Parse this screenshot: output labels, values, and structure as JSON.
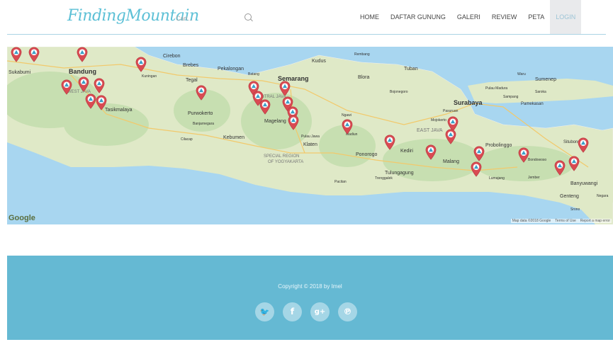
{
  "header": {
    "logo": "FindingMountain",
    "search_placeholder": "Cari...",
    "nav": [
      {
        "label": "HOME"
      },
      {
        "label": "DAFTAR GUNUNG"
      },
      {
        "label": "GALERI"
      },
      {
        "label": "REVIEW"
      },
      {
        "label": "PETA"
      },
      {
        "label": "LOGIN"
      }
    ]
  },
  "map": {
    "provider": "Google",
    "attribution": [
      "Map data ©2018 Google",
      "Terms of Use",
      "Report a map error"
    ],
    "labels": {
      "sukabumi": "Sukabumi",
      "bandung": "Bandung",
      "cirebon": "Cirebon",
      "kuningan": "Kuningan",
      "brebes": "Brebes",
      "tegal": "Tegal",
      "pekalongan": "Pekalongan",
      "batang": "Batang",
      "semarang": "Semarang",
      "kudus": "Kudus",
      "rembang": "Rembang",
      "blora": "Blora",
      "tuban": "Tuban",
      "bojonegoro": "Bojonegoro",
      "surabaya": "Surabaya",
      "pulau_madura": "Pulau Madura",
      "sumenep": "Sumenep",
      "pamekasan": "Pamekasan",
      "sampang": "Sampang",
      "saroka": "Saroka",
      "waru": "Waru",
      "tasikmalaya": "Tasikmalaya",
      "purwokerto": "Purwokerto",
      "banjarnegara": "Banjarnegara",
      "kebumen": "Kebumen",
      "cilacap": "Cilacap",
      "magelang": "Magelang",
      "pulau_jawa": "Pulau Jawa",
      "klaten": "Klaten",
      "special_region": "SPECIAL REGION",
      "of_yogyakarta": "OF YOGYAKARTA",
      "ngawi": "Ngawi",
      "madiun": "Madiun",
      "east_java": "EAST JAVA",
      "mojokerto": "Mojokerto",
      "pasuruan": "Pasuruan",
      "probolinggo": "Probolinggo",
      "situbondo": "Situbondo",
      "bondowoso": "Bondowoso",
      "kediri": "Kediri",
      "ponorogo": "Ponorogo",
      "malang": "Malang",
      "tulungagung": "Tulungagung",
      "trenggalek": "Trenggalek",
      "pacitan": "Pacitan",
      "lumajang": "Lumajang",
      "jember": "Jember",
      "banyuwangi": "Banyuwangi",
      "genteng": "Genteng",
      "srono": "Srono",
      "negara": "Negara",
      "central_java": "CENTRAL JAVA",
      "west_java": "WEST JAVA"
    },
    "marker_count": 40
  },
  "footer": {
    "copyright": "Copyright © 2018 by Imel",
    "social": [
      {
        "name": "twitter",
        "glyph": "🐦"
      },
      {
        "name": "facebook",
        "glyph": "f"
      },
      {
        "name": "google-plus",
        "glyph": "g+"
      },
      {
        "name": "pinterest",
        "glyph": "℗"
      }
    ]
  },
  "colors": {
    "accent": "#5cc0d6",
    "footer": "#65b9d3",
    "marker": "#d94a52",
    "sea": "#a8d6f0",
    "land": "#dfe9c7"
  }
}
